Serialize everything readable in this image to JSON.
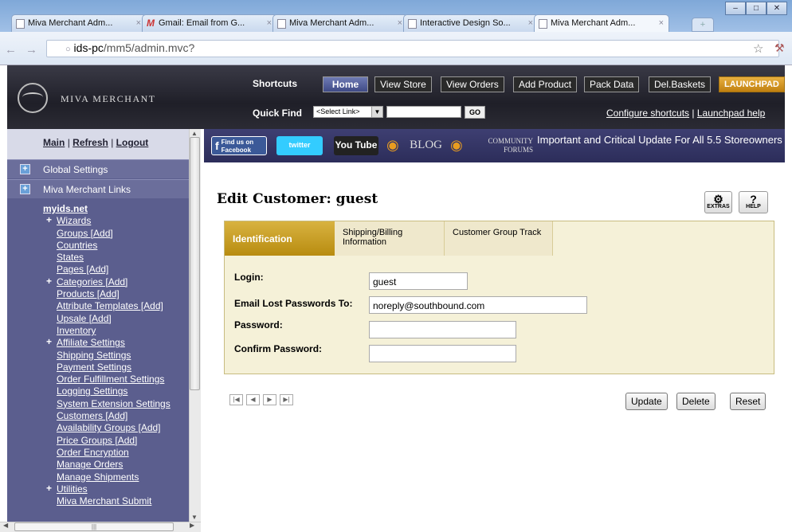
{
  "browser": {
    "tabs": [
      {
        "label": "Miva Merchant Adm...",
        "icon": "page-icon"
      },
      {
        "label": "Gmail: Email from G...",
        "icon": "gmail-icon"
      },
      {
        "label": "Miva Merchant Adm...",
        "icon": "page-icon"
      },
      {
        "label": "Interactive Design So...",
        "icon": "page-icon"
      },
      {
        "label": "Miva Merchant Adm...",
        "icon": "page-icon"
      }
    ],
    "url_host": "ids-pc",
    "url_path": "/mm5/admin.mvc?"
  },
  "header": {
    "logo_text": "MIVA MERCHANT",
    "shortcuts_label": "Shortcuts",
    "quickfind_label": "Quick Find",
    "buttons": {
      "home": "Home",
      "view_store": "View Store",
      "view_orders": "View Orders",
      "add_product": "Add Product",
      "pack_data": "Pack Data",
      "del_baskets": "Del.Baskets",
      "launchpad": "LAUNCHPAD"
    },
    "select_value": "<Select Link>",
    "go_label": "GO",
    "configure_link": "Configure shortcuts",
    "separator": "|",
    "launchpad_help": "Launchpad help"
  },
  "sidebar": {
    "main": "Main",
    "refresh": "Refresh",
    "logout": "Logout",
    "sep": "|",
    "global_settings": "Global Settings",
    "links": "Miva Merchant Links",
    "site": "myids.net",
    "items": [
      {
        "label": "Wizards",
        "plus": true
      },
      {
        "label": "Groups  [Add]",
        "plus": false
      },
      {
        "label": "Countries",
        "plus": false
      },
      {
        "label": "States",
        "plus": false
      },
      {
        "label": "Pages  [Add]",
        "plus": false
      },
      {
        "label": "Categories  [Add]",
        "plus": true
      },
      {
        "label": "Products  [Add]",
        "plus": false
      },
      {
        "label": "Attribute Templates  [Add]",
        "plus": false
      },
      {
        "label": "Upsale  [Add]",
        "plus": false
      },
      {
        "label": "Inventory",
        "plus": false
      },
      {
        "label": "Affiliate Settings",
        "plus": true
      },
      {
        "label": "Shipping Settings",
        "plus": false
      },
      {
        "label": "Payment Settings",
        "plus": false
      },
      {
        "label": "Order Fulfillment Settings",
        "plus": false
      },
      {
        "label": "Logging Settings",
        "plus": false
      },
      {
        "label": "System Extension Settings",
        "plus": false
      },
      {
        "label": "Customers  [Add]",
        "plus": false
      },
      {
        "label": "Availability Groups  [Add]",
        "plus": false
      },
      {
        "label": "Price Groups  [Add]",
        "plus": false
      },
      {
        "label": "Order Encryption",
        "plus": false
      },
      {
        "label": "Manage Orders",
        "plus": false
      },
      {
        "label": "Manage Shipments",
        "plus": false
      },
      {
        "label": "Utilities",
        "plus": true
      },
      {
        "label": "Miva Merchant Submit",
        "plus": false
      }
    ]
  },
  "social": {
    "facebook": "Find us on Facebook",
    "twitter": "twitter",
    "youtube": "You Tube",
    "blog": "BLOG",
    "forums": "COMMUNITY FORUMS",
    "update": "Important and Critical Update For All 5.5 Storeowners"
  },
  "main": {
    "title": "Edit Customer: guest",
    "extras": "EXTRAS",
    "help": "HELP",
    "tabs": [
      "Identification",
      "Shipping/Billing Information",
      "Customer Group Track"
    ],
    "fields": {
      "login_label": "Login:",
      "login_value": "guest",
      "email_label": "Email Lost Passwords To:",
      "email_value": "noreply@southbound.com",
      "password_label": "Password:",
      "confirm_label": "Confirm Password:"
    },
    "buttons": {
      "update": "Update",
      "delete": "Delete",
      "reset": "Reset"
    }
  }
}
